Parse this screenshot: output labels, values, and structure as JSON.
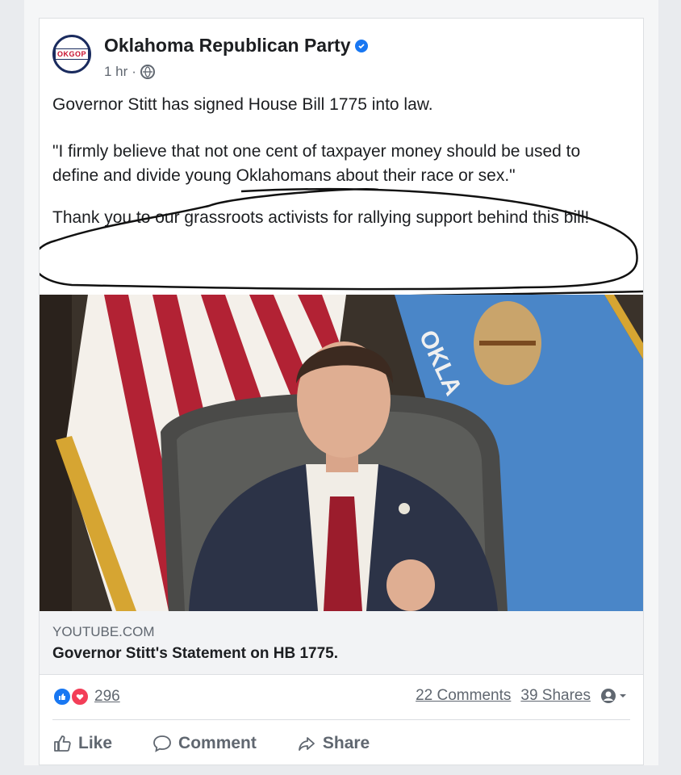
{
  "post": {
    "author": "Oklahoma Republican Party",
    "avatar_text": "OKGOP",
    "time": "1 hr",
    "separator": "·",
    "paragraphs": [
      "Governor Stitt has signed House Bill 1775 into law.",
      "\"I firmly believe that not one cent of taxpayer money should be used to define and divide young Oklahomans about their race or sex.\"",
      "Thank you to our grassroots activists for rallying support behind this bill!"
    ]
  },
  "link": {
    "domain": "YOUTUBE.COM",
    "title": "Governor Stitt's Statement on HB 1775.",
    "flag_text": "OKLA"
  },
  "engagement": {
    "reaction_count": "296",
    "comments": "22 Comments",
    "shares": "39 Shares"
  },
  "actions": {
    "like": "Like",
    "comment": "Comment",
    "share": "Share"
  },
  "colors": {
    "brand_blue": "#1877f2",
    "love_red": "#f33e58",
    "flag_blue": "#4a86c8"
  }
}
